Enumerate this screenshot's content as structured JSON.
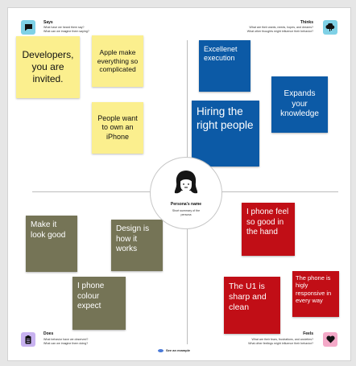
{
  "quadrants": {
    "says": {
      "title": "Says",
      "sub1": "What have we heard them say?",
      "sub2": "What can we imagine them saying?",
      "icon": "speech-bubble-icon",
      "color": "#7fd1e6"
    },
    "thinks": {
      "title": "Thinks",
      "sub1": "What are their wants, needs, hopes, and dreams?",
      "sub2": "What other thoughts might influence their behavior?",
      "icon": "thought-cloud-icon",
      "color": "#7fd1e6"
    },
    "does": {
      "title": "Does",
      "sub1": "What behavior have we observed?",
      "sub2": "What can we imagine them doing?",
      "icon": "clipboard-icon",
      "color": "#c8b2f0"
    },
    "feels": {
      "title": "Feels",
      "sub1": "What are their fears, frustrations, and anxieties?",
      "sub2": "What other feelings might influence their behavior?",
      "icon": "heart-icon",
      "color": "#f4a9c8"
    }
  },
  "persona": {
    "name": "Persona's name",
    "summary": "Short summary of the persona"
  },
  "notes": {
    "says": [
      "Developers, you are invited.",
      "Apple make everything so complicated",
      "People want to own an iPhone"
    ],
    "thinks": [
      "Excellenet execution",
      "Expands your knowledge",
      "Hiring the right people"
    ],
    "does": [
      "Make it look good",
      "Design is how it works",
      "I phone colour expect"
    ],
    "feels": [
      "I phone feel so good in the hand",
      "The phone is higly responsive in every way",
      "The U1 is sharp and clean"
    ]
  },
  "example_link": "See an example"
}
